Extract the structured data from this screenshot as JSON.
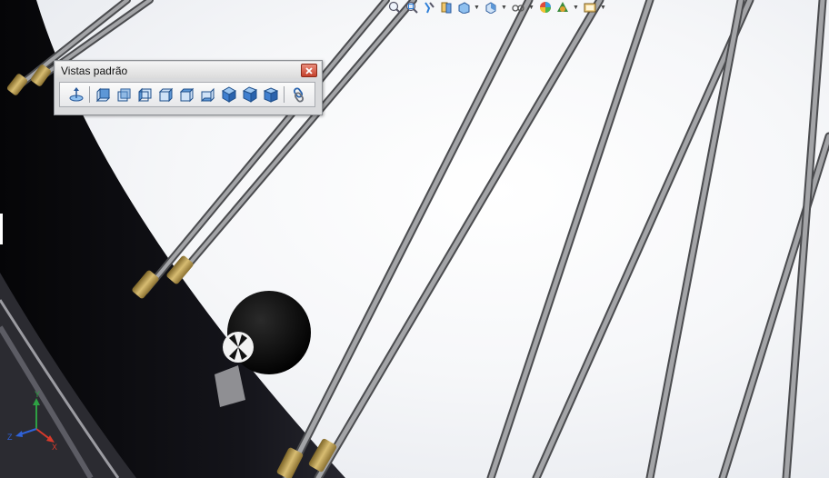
{
  "palette": {
    "title": "Vistas padrão",
    "buttons": [
      {
        "name": "normal-to-view-button",
        "icon": "normal-to-icon"
      },
      {
        "name": "front-view-button",
        "icon": "front-view-icon"
      },
      {
        "name": "back-view-button",
        "icon": "back-view-icon"
      },
      {
        "name": "left-view-button",
        "icon": "left-view-icon"
      },
      {
        "name": "right-view-button",
        "icon": "right-view-icon"
      },
      {
        "name": "top-view-button",
        "icon": "top-view-icon"
      },
      {
        "name": "bottom-view-button",
        "icon": "bottom-view-icon"
      },
      {
        "name": "isometric-view-button",
        "icon": "isometric-view-icon"
      },
      {
        "name": "trimetric-view-button",
        "icon": "trimetric-view-icon"
      },
      {
        "name": "dimetric-view-button",
        "icon": "dimetric-view-icon"
      },
      {
        "name": "link-view-button",
        "icon": "link-view-icon"
      }
    ]
  },
  "heads_up_toolbar": [
    "zoom-to-fit-icon",
    "zoom-to-area-icon",
    "previous-view-icon",
    "section-view-icon",
    "view-orientation-icon",
    "display-style-icon",
    "hide-show-items-icon",
    "edit-appearance-icon",
    "apply-scene-icon",
    "view-settings-icon"
  ],
  "triad": {
    "x_label": "X",
    "y_label": "Y",
    "z_label": "Z"
  },
  "colors": {
    "accent": "#2f7fd8",
    "rim": "#0d0d12",
    "spoke": "#7a7b7e",
    "nipple": "#b89a4e"
  }
}
